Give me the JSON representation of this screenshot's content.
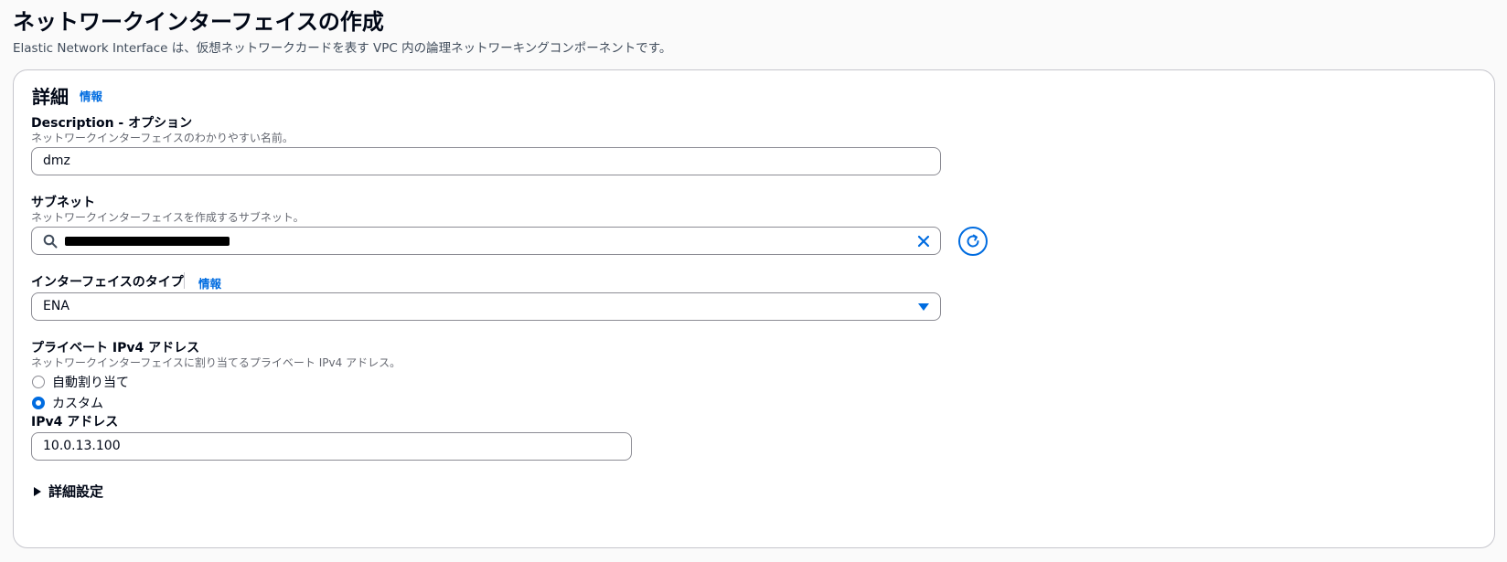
{
  "page": {
    "title": "ネットワークインターフェイスの作成",
    "description": "Elastic Network Interface は、仮想ネットワークカードを表す VPC 内の論理ネットワーキングコンポーネントです。"
  },
  "details": {
    "title": "詳細",
    "info_label": "情報",
    "description_field": {
      "label": "Description - オプション",
      "hint": "ネットワークインターフェイスのわかりやすい名前。",
      "value": "dmz"
    },
    "subnet_field": {
      "label": "サブネット",
      "hint": "ネットワークインターフェイスを作成するサブネット。",
      "value_redacted": true
    },
    "interface_type_field": {
      "label": "インターフェイスのタイプ",
      "info_label": "情報",
      "selected": "ENA"
    },
    "private_ipv4": {
      "label": "プライベート IPv4 アドレス",
      "hint": "ネットワークインターフェイスに割り当てるプライベート IPv4 アドレス。",
      "options": [
        {
          "label": "自動割り当て",
          "checked": false
        },
        {
          "label": "カスタム",
          "checked": true
        }
      ],
      "address_label": "IPv4 アドレス",
      "address_value": "10.0.13.100"
    },
    "advanced": {
      "label": "詳細設定"
    }
  },
  "colors": {
    "accent": "#006ce0",
    "text": "#000716",
    "border": "#8c8c94"
  }
}
